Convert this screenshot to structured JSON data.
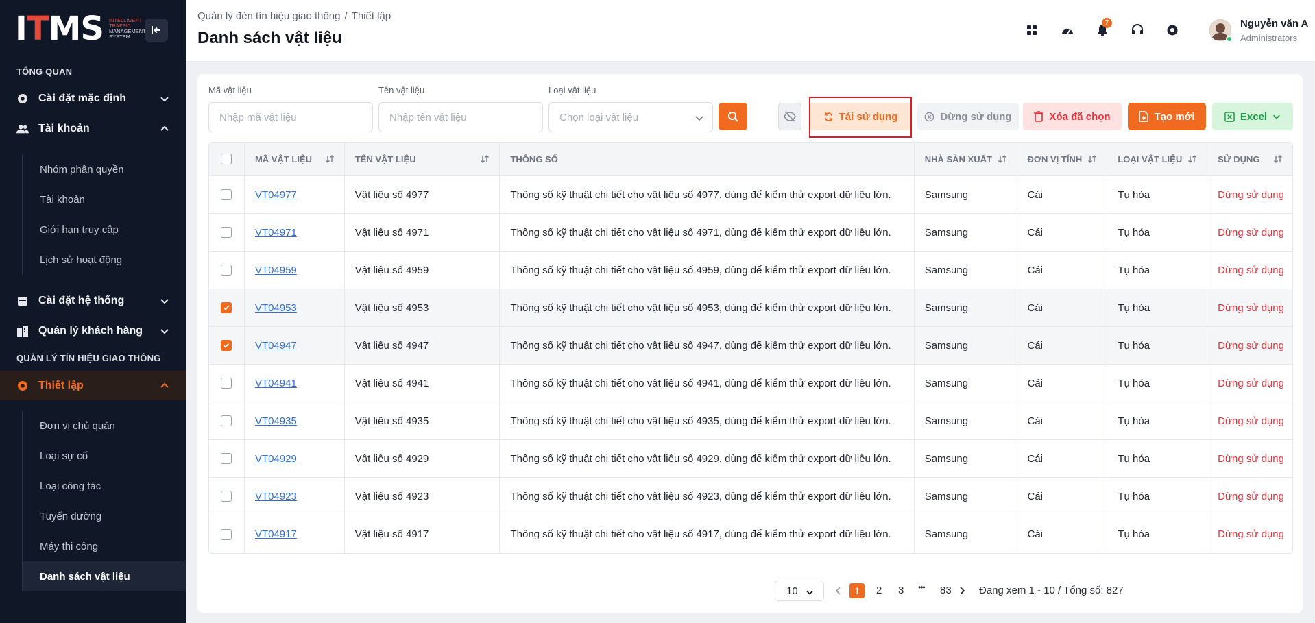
{
  "brand": {
    "logo_text": "ITMS",
    "logo_sub_1": "INTELLIGENT",
    "logo_sub_2": "TRAFFIC",
    "logo_sub_3": "MANAGEMENT",
    "logo_sub_4": "SYSTEM"
  },
  "sidebar": {
    "section_overview": "TỔNG QUAN",
    "item_default_settings": "Cài đặt mặc định",
    "item_accounts": "Tài khoản",
    "accounts_sub": [
      "Nhóm phân quyền",
      "Tài khoản",
      "Giới hạn truy cập",
      "Lịch sử hoạt động"
    ],
    "item_system_settings": "Cài đặt hệ thống",
    "item_customers": "Quản lý khách hàng",
    "section_traffic": "QUẢN LÝ TÍN HIỆU GIAO THÔNG",
    "item_setup": "Thiết lập",
    "setup_sub": [
      "Đơn vị chủ quản",
      "Loại sự cố",
      "Loại công tác",
      "Tuyến đường",
      "Máy thi công",
      "Danh sách vật liệu"
    ]
  },
  "header": {
    "breadcrumb_1": "Quản lý đèn tín hiệu giao thông",
    "breadcrumb_sep": "/",
    "breadcrumb_2": "Thiết lập",
    "title": "Danh sách vật liệu",
    "notif_count": "7",
    "user_name": "Nguyễn văn A",
    "user_role": "Administrators"
  },
  "filters": {
    "code_label": "Mã vật liệu",
    "code_placeholder": "Nhập mã vật liệu",
    "name_label": "Tên vật liệu",
    "name_placeholder": "Nhập tên vật liệu",
    "type_label": "Loại vật liệu",
    "type_placeholder": "Chọn loại vật liệu"
  },
  "actions": {
    "reuse": "Tái sử dụng",
    "stop": "Dừng sử dụng",
    "delete_selected": "Xóa đã chọn",
    "create": "Tạo mới",
    "excel": "Excel"
  },
  "table": {
    "headers": [
      "MÃ VẬT LIỆU",
      "TÊN VẬT LIỆU",
      "THÔNG SỐ",
      "NHÀ SẢN XUẤT",
      "ĐƠN VỊ TÍNH",
      "LOẠI VẬT LIỆU",
      "SỬ DỤNG"
    ],
    "rows": [
      {
        "checked": false,
        "code": "VT04977",
        "name": "Vật liệu số 4977",
        "spec": "Thông số kỹ thuật chi tiết cho vật liệu số 4977, dùng để kiểm thử export dữ liệu lớn.",
        "maker": "Samsung",
        "unit": "Cái",
        "type": "Tụ hóa",
        "status": "Dừng sử dụng"
      },
      {
        "checked": false,
        "code": "VT04971",
        "name": "Vật liệu số 4971",
        "spec": "Thông số kỹ thuật chi tiết cho vật liệu số 4971, dùng để kiểm thử export dữ liệu lớn.",
        "maker": "Samsung",
        "unit": "Cái",
        "type": "Tụ hóa",
        "status": "Dừng sử dụng"
      },
      {
        "checked": false,
        "code": "VT04959",
        "name": "Vật liệu số 4959",
        "spec": "Thông số kỹ thuật chi tiết cho vật liệu số 4959, dùng để kiểm thử export dữ liệu lớn.",
        "maker": "Samsung",
        "unit": "Cái",
        "type": "Tụ hóa",
        "status": "Dừng sử dụng"
      },
      {
        "checked": true,
        "code": "VT04953",
        "name": "Vật liệu số 4953",
        "spec": "Thông số kỹ thuật chi tiết cho vật liệu số 4953, dùng để kiểm thử export dữ liệu lớn.",
        "maker": "Samsung",
        "unit": "Cái",
        "type": "Tụ hóa",
        "status": "Dừng sử dụng"
      },
      {
        "checked": true,
        "code": "VT04947",
        "name": "Vật liệu số 4947",
        "spec": "Thông số kỹ thuật chi tiết cho vật liệu số 4947, dùng để kiểm thử export dữ liệu lớn.",
        "maker": "Samsung",
        "unit": "Cái",
        "type": "Tụ hóa",
        "status": "Dừng sử dụng"
      },
      {
        "checked": false,
        "code": "VT04941",
        "name": "Vật liệu số 4941",
        "spec": "Thông số kỹ thuật chi tiết cho vật liệu số 4941, dùng để kiểm thử export dữ liệu lớn.",
        "maker": "Samsung",
        "unit": "Cái",
        "type": "Tụ hóa",
        "status": "Dừng sử dụng"
      },
      {
        "checked": false,
        "code": "VT04935",
        "name": "Vật liệu số 4935",
        "spec": "Thông số kỹ thuật chi tiết cho vật liệu số 4935, dùng để kiểm thử export dữ liệu lớn.",
        "maker": "Samsung",
        "unit": "Cái",
        "type": "Tụ hóa",
        "status": "Dừng sử dụng"
      },
      {
        "checked": false,
        "code": "VT04929",
        "name": "Vật liệu số 4929",
        "spec": "Thông số kỹ thuật chi tiết cho vật liệu số 4929, dùng để kiểm thử export dữ liệu lớn.",
        "maker": "Samsung",
        "unit": "Cái",
        "type": "Tụ hóa",
        "status": "Dừng sử dụng"
      },
      {
        "checked": false,
        "code": "VT04923",
        "name": "Vật liệu số 4923",
        "spec": "Thông số kỹ thuật chi tiết cho vật liệu số 4923, dùng để kiểm thử export dữ liệu lớn.",
        "maker": "Samsung",
        "unit": "Cái",
        "type": "Tụ hóa",
        "status": "Dừng sử dụng"
      },
      {
        "checked": false,
        "code": "VT04917",
        "name": "Vật liệu số 4917",
        "spec": "Thông số kỹ thuật chi tiết cho vật liệu số 4917, dùng để kiểm thử export dữ liệu lớn.",
        "maker": "Samsung",
        "unit": "Cái",
        "type": "Tụ hóa",
        "status": "Dừng sử dụng"
      }
    ]
  },
  "pagination": {
    "page_size": "10",
    "pages": [
      "1",
      "2",
      "3"
    ],
    "ellipsis": "•••",
    "last_page": "83",
    "info": "Đang xem 1 - 10 / Tổng số: 827"
  },
  "colors": {
    "accent": "#f06a1f",
    "sidebar_bg": "#101727",
    "danger": "#e5323b",
    "link": "#2f6fd6",
    "success": "#1a9e46"
  }
}
